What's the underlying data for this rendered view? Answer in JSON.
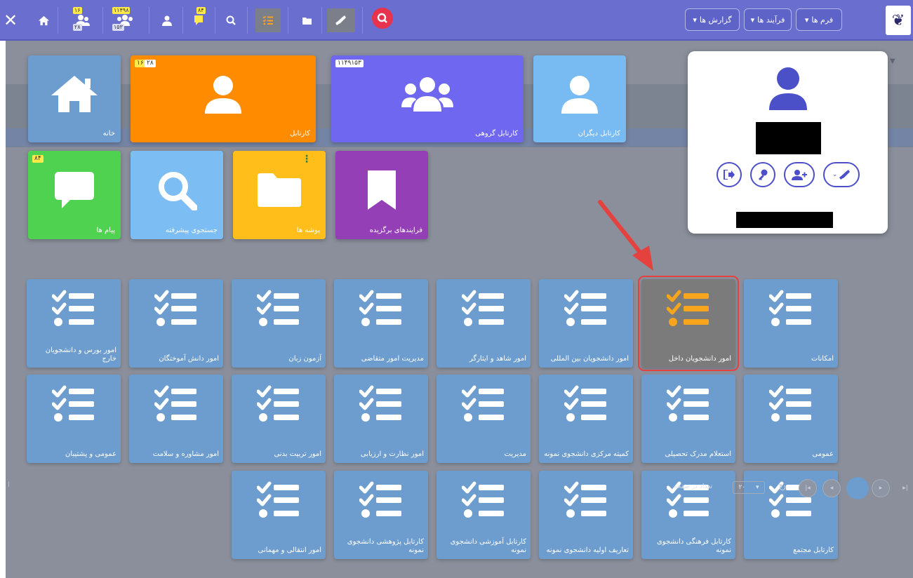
{
  "topbar": {
    "close": "✕",
    "badges": {
      "group_top": "۱۶",
      "group_bottom": "۲۸",
      "people_top": "۱۱۴۹۸",
      "people_bottom": "۱۵۳",
      "msg": "۸۴"
    },
    "menus": [
      "فرم ها",
      "فرآیند ها",
      "گزارش ها"
    ]
  },
  "tiles": {
    "home": "خانه",
    "kartable": "کارتابل",
    "kartable_badge_a": "۱۶",
    "kartable_badge_b": "۲۸",
    "group": "کارتابل گروهی",
    "group_badge": "۱۱۴۹۱۵۳",
    "others": "کارتابل دیگران",
    "messages": "پیام ها",
    "messages_badge": "۸۴",
    "search": "جستجوی پیشرفته",
    "folders": "پوشه ها",
    "favorites": "فرایندهای برگزیده"
  },
  "menu_tiles": [
    [
      "امکانات",
      "امور دانشجویان داخل",
      "امور دانشجویان بین المللی",
      "امور شاهد و ایثارگر",
      "مدیریت امور متقاضی",
      "آزمون زبان",
      "امور دانش آموختگان",
      "امور بورس و دانشجویان خارج"
    ],
    [
      "عمومی",
      "استعلام مدرک تحصیلی",
      "کمیته مرکزی دانشجوی نمونه",
      "مدیریت",
      "امور نظارت و ارزیابی",
      "امور تربیت بدنی",
      "امور مشاوره و سلامت",
      "عمومی و پشتیبان"
    ],
    [
      "کارتابل مجتمع",
      "کارتابل فرهنگی دانشجوی نمونه",
      "تعاریف اولیه دانشجوی نمونه",
      "کارتابل آموزشی دانشجوی نمونه",
      "کارتابل پژوهشی دانشجوی نمونه",
      "امور انتقالی و مهمانی"
    ]
  ],
  "pager": {
    "page_size": "۲۰",
    "page_size_label": "تعداد در صفحه",
    "left_stub": "ا"
  },
  "colors": {
    "topbar": "#6a6ecf",
    "tile_blue": "#6d9dce",
    "orange": "#ff8c00",
    "purple": "#7067f0",
    "light_blue": "#78baf2",
    "green": "#4fd24f",
    "sky": "#7cbdf3",
    "yellow": "#ffbe1a",
    "violet": "#943fb5",
    "selected": "#7b7b7b",
    "selected_icon": "#f7a51d",
    "highlight": "#e4413f"
  }
}
